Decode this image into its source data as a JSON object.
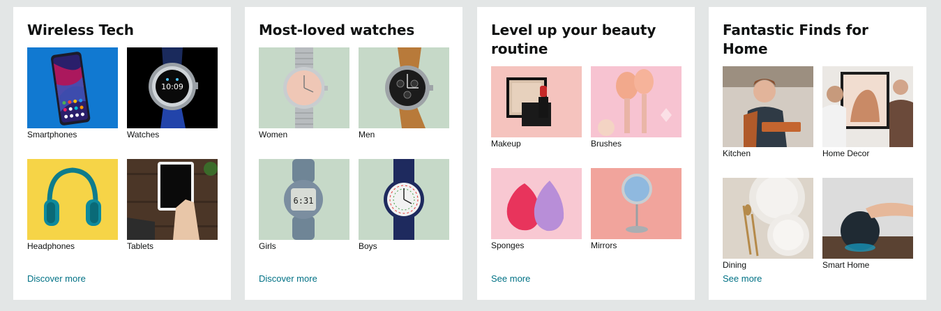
{
  "cards": [
    {
      "title": "Wireless Tech",
      "link": "Discover more",
      "items": [
        {
          "label": "Smartphones",
          "icon": "smartphone-image"
        },
        {
          "label": "Watches",
          "icon": "smartwatch-image"
        },
        {
          "label": "Headphones",
          "icon": "headphones-image"
        },
        {
          "label": "Tablets",
          "icon": "tablet-image"
        }
      ]
    },
    {
      "title": "Most-loved watches",
      "link": "Discover more",
      "items": [
        {
          "label": "Women",
          "icon": "womens-watch-image"
        },
        {
          "label": "Men",
          "icon": "mens-watch-image"
        },
        {
          "label": "Girls",
          "icon": "girls-watch-image"
        },
        {
          "label": "Boys",
          "icon": "boys-watch-image"
        }
      ]
    },
    {
      "title": "Level up your beauty routine",
      "link": "See more",
      "items": [
        {
          "label": "Makeup",
          "icon": "makeup-image"
        },
        {
          "label": "Brushes",
          "icon": "brushes-image"
        },
        {
          "label": "Sponges",
          "icon": "sponges-image"
        },
        {
          "label": "Mirrors",
          "icon": "mirror-image"
        }
      ]
    },
    {
      "title": "Fantastic Finds for Home",
      "link": "See more",
      "items": [
        {
          "label": "Kitchen",
          "icon": "kitchen-image"
        },
        {
          "label": "Home Decor",
          "icon": "home-decor-image"
        },
        {
          "label": "Dining",
          "icon": "dining-image"
        },
        {
          "label": "Smart Home",
          "icon": "smart-home-image"
        }
      ]
    }
  ],
  "colors": {
    "page_bg": "#e3e6e6",
    "card_bg": "#ffffff",
    "link": "#007185",
    "text": "#0f1111",
    "watch_bg": "#c5d9c8",
    "beauty_pink": "#f7c6c4"
  }
}
